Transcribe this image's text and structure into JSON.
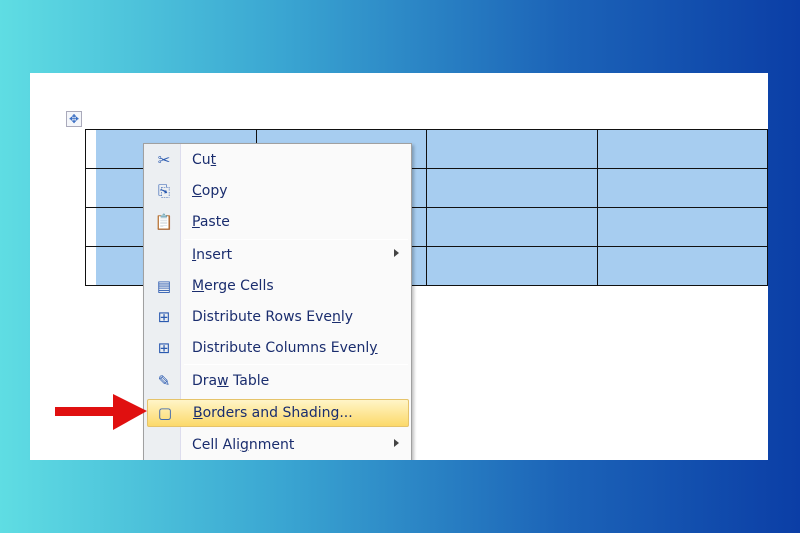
{
  "menu": {
    "items": [
      {
        "icon": "scissors-icon",
        "pre": "Cu",
        "key": "t",
        "post": ""
      },
      {
        "icon": "copy-icon",
        "pre": "",
        "key": "C",
        "post": "opy"
      },
      {
        "icon": "paste-icon",
        "pre": "",
        "key": "P",
        "post": "aste"
      },
      {
        "icon": "",
        "pre": "",
        "key": "I",
        "post": "nsert",
        "submenu": true
      },
      {
        "icon": "merge-cells-icon",
        "pre": "",
        "key": "M",
        "post": "erge Cells"
      },
      {
        "icon": "distribute-rows-icon",
        "pre": "Distribute Rows Eve",
        "key": "n",
        "post": "ly"
      },
      {
        "icon": "distribute-columns-icon",
        "pre": "Distribute Columns Evenl",
        "key": "y",
        "post": ""
      },
      {
        "icon": "draw-table-icon",
        "pre": "Dra",
        "key": "w",
        "post": " Table"
      },
      {
        "icon": "borders-shading-icon",
        "pre": "",
        "key": "B",
        "post": "orders and Shading...",
        "highlighted": true
      },
      {
        "icon": "",
        "pre": "Cell Ali",
        "key": "g",
        "post": "nment",
        "submenu": true
      }
    ]
  },
  "colors": {
    "highlight": "#fcd96a",
    "cell": "#a7cdf0",
    "arrow": "#e01010"
  }
}
